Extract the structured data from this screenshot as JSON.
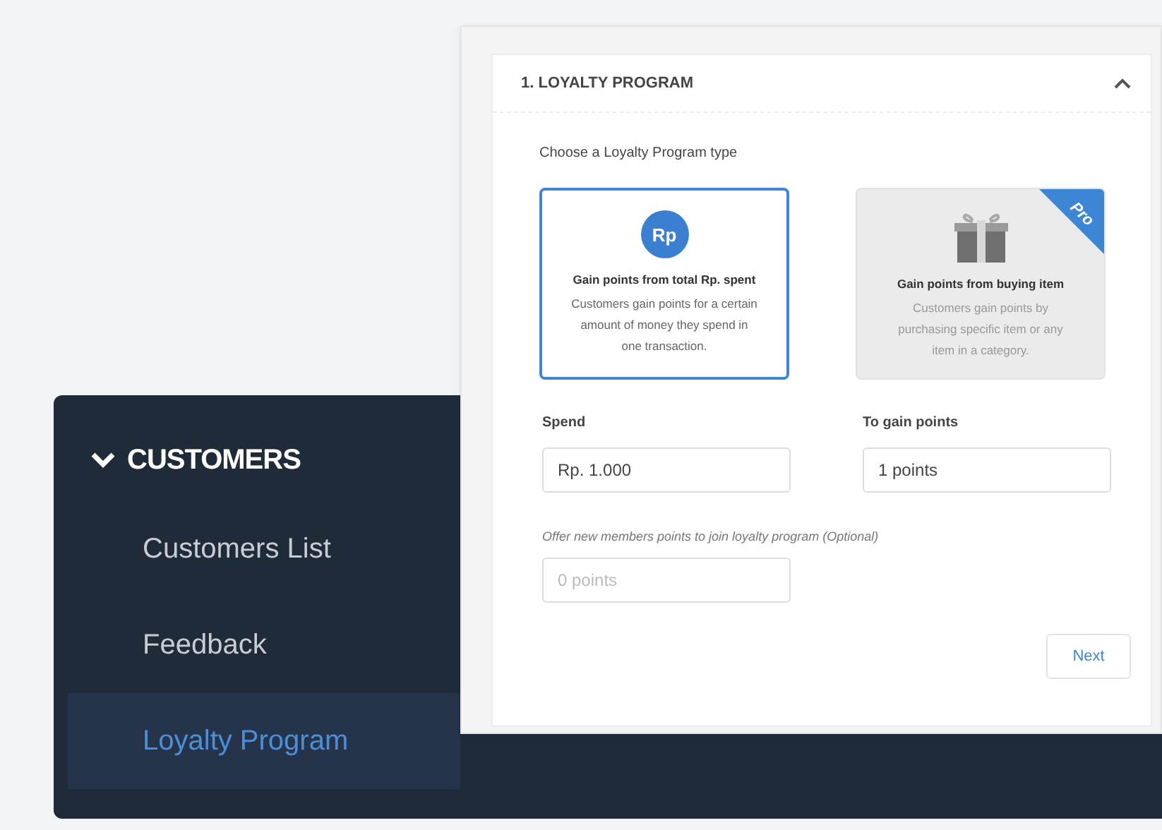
{
  "sidebar": {
    "section": {
      "label": "CUSTOMERS",
      "expanded": true
    },
    "items": [
      {
        "label": "Customers List",
        "selected": false
      },
      {
        "label": "Feedback",
        "selected": false
      },
      {
        "label": "Loyalty Program",
        "selected": true
      }
    ]
  },
  "panel": {
    "title": "1. LOYALTY PROGRAM",
    "expanded": true,
    "prompt": "Choose a Loyalty Program type",
    "options": [
      {
        "kind": "currency",
        "icon_text": "Rp",
        "title": "Gain points from total Rp. spent",
        "description": "Customers gain points for a certain amount of money they spend in one transaction.",
        "selected": true
      },
      {
        "kind": "gift",
        "badge": "Pro",
        "title": "Gain points from buying item",
        "description": "Customers gain points by purchasing specific item or any item in a category.",
        "selected": false
      }
    ],
    "fields": [
      {
        "label": "Spend",
        "value": "Rp. 1.000"
      },
      {
        "label": "To gain points",
        "value": "1 points"
      }
    ],
    "optional_field": {
      "label": "Offer new members points to join loyalty program (Optional)",
      "placeholder": "0 points"
    },
    "next_button": "Next"
  }
}
